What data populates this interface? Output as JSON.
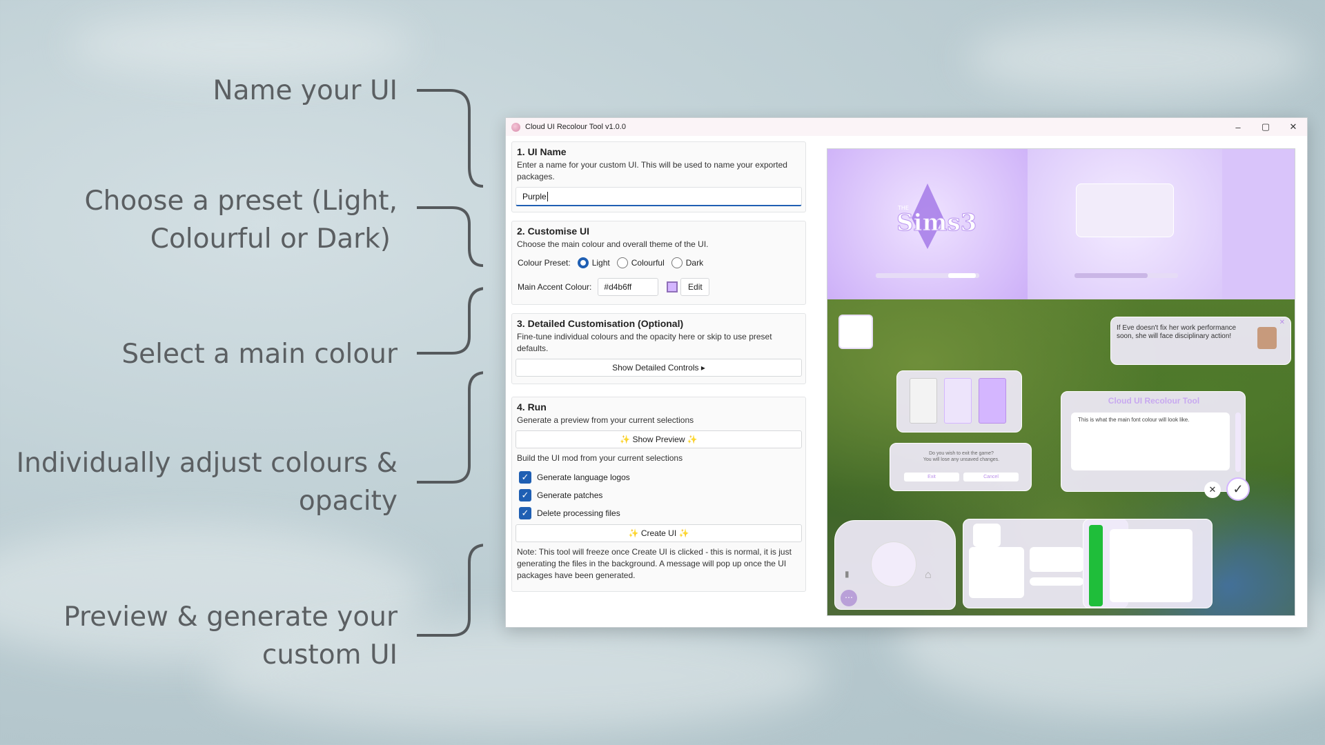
{
  "annotations": {
    "name_ui": "Name your UI",
    "preset_line1": "Choose a preset (Light,",
    "preset_line2": "Colourful or Dark)",
    "main_colour": "Select a main colour",
    "adjust_line1": "Individually adjust colours &",
    "adjust_line2": "opacity",
    "generate_line1": "Preview & generate your",
    "generate_line2": "custom UI"
  },
  "window": {
    "title": "Cloud UI Recolour Tool v1.0.0",
    "controls": {
      "minimize": "–",
      "maximize": "▢",
      "close": "✕"
    }
  },
  "section1": {
    "title": "1. UI Name",
    "desc": "Enter a name for your custom UI. This will be used to name your exported packages.",
    "name_value": "Purple"
  },
  "section2": {
    "title": "2. Customise UI",
    "desc": "Choose the main colour and overall theme of the UI.",
    "preset_label": "Colour Preset:",
    "presets": [
      "Light",
      "Colourful",
      "Dark"
    ],
    "selected_preset": "Light",
    "accent_label": "Main Accent Colour:",
    "accent_value": "#d4b6ff",
    "edit_label": "Edit"
  },
  "section3": {
    "title": "3. Detailed Customisation (Optional)",
    "desc": "Fine-tune individual colours and the opacity here or skip to use preset defaults.",
    "toggle_label": "Show Detailed Controls ▸"
  },
  "section4": {
    "title": "4. Run",
    "preview_desc": "Generate a preview from your current selections",
    "preview_label": "Show Preview",
    "build_desc": "Build the UI mod from your current selections",
    "options": [
      {
        "label": "Generate language logos",
        "checked": true
      },
      {
        "label": "Generate patches",
        "checked": true
      },
      {
        "label": "Delete processing files",
        "checked": true
      }
    ],
    "create_label": "Create UI",
    "note": "Note: This tool will freeze once Create UI is clicked - this is normal, it is just generating the files in the background. A message will pop up once the UI packages have been generated."
  },
  "preview": {
    "logo_text": "Sims3",
    "logo_small": "THE",
    "notification_text": "If Eve doesn't fix her work performance soon, she will face disciplinary action!",
    "dialog_title": "Cloud UI Recolour Tool",
    "dialog_body": "This is what the main font colour will look like.",
    "exit_prompt_line1": "Do you wish to exit the game?",
    "exit_prompt_line2": "You will lose any unsaved changes.",
    "exit_label": "Exit",
    "cancel_label": "Cancel"
  },
  "colors": {
    "accent": "#d4b6ff",
    "selection_blue": "#1f5fb3",
    "annotation_text": "#5b5f62",
    "game_green": "#1fbe3a"
  },
  "icons": [
    "sparkle-icon",
    "checkmark-icon",
    "close-icon",
    "camera-icon",
    "home-icon",
    "ellipsis-icon"
  ]
}
